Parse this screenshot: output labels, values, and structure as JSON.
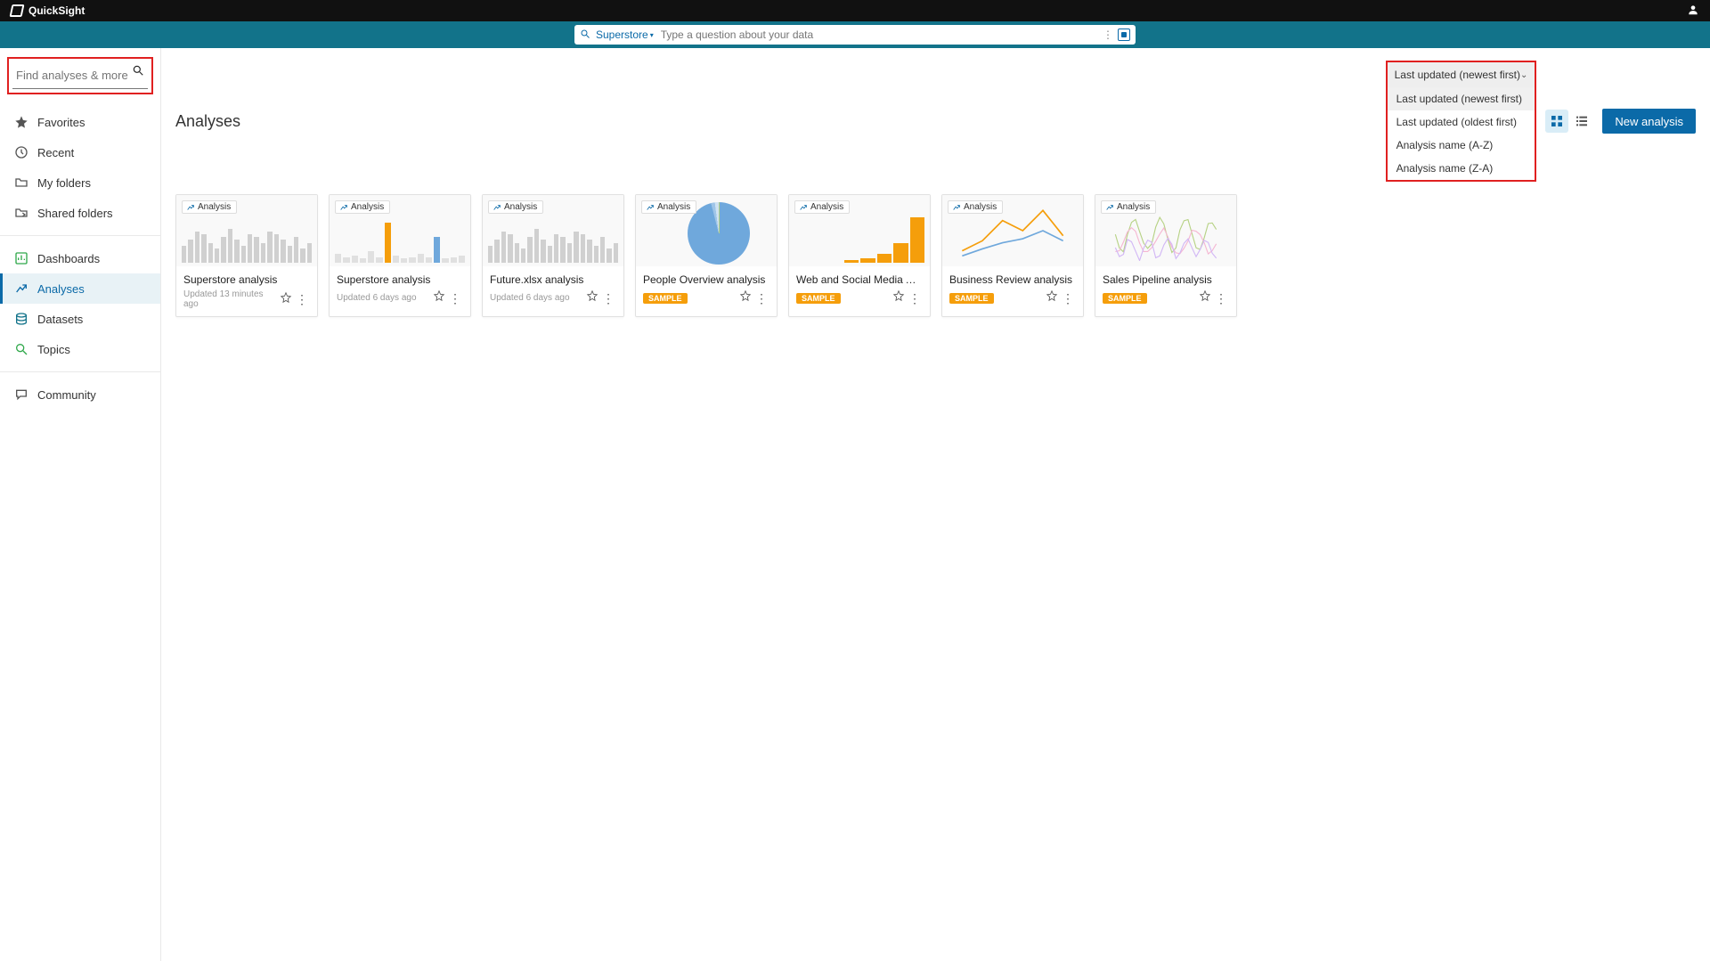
{
  "brand": "QuickSight",
  "askbar": {
    "topic": "Superstore",
    "placeholder": "Type a question about your data"
  },
  "side_search": {
    "placeholder": "Find analyses & more"
  },
  "sidebar": {
    "items": [
      {
        "label": "Favorites",
        "icon": "star"
      },
      {
        "label": "Recent",
        "icon": "clock"
      },
      {
        "label": "My folders",
        "icon": "folder"
      },
      {
        "label": "Shared folders",
        "icon": "folder-share"
      }
    ],
    "items2": [
      {
        "label": "Dashboards",
        "icon": "dashboard",
        "color": "#2fa84a"
      },
      {
        "label": "Analyses",
        "icon": "analysis",
        "color": "#0b6aa8",
        "selected": true
      },
      {
        "label": "Datasets",
        "icon": "dataset",
        "color": "#12738a"
      },
      {
        "label": "Topics",
        "icon": "topic",
        "color": "#2fa84a"
      }
    ],
    "items3": [
      {
        "label": "Community",
        "icon": "chat"
      }
    ]
  },
  "page": {
    "title": "Analyses",
    "sort_selected": "Last updated (newest first)",
    "sort_options": [
      "Last updated (newest first)",
      "Last updated (oldest first)",
      "Analysis name (A-Z)",
      "Analysis name (Z-A)"
    ],
    "new_button": "New analysis",
    "card_tag": "Analysis",
    "sample_badge": "SAMPLE"
  },
  "cards": [
    {
      "title": "Superstore analysis",
      "meta": "Updated 13 minutes ago",
      "thumb": "bars-gray"
    },
    {
      "title": "Superstore analysis",
      "meta": "Updated 6 days ago",
      "thumb": "bars-accent"
    },
    {
      "title": "Future.xlsx analysis",
      "meta": "Updated 6 days ago",
      "thumb": "bars-gray"
    },
    {
      "title": "People Overview analysis",
      "sample": true,
      "thumb": "pie"
    },
    {
      "title": "Web and Social Media Anal…",
      "sample": true,
      "thumb": "bars-orange"
    },
    {
      "title": "Business Review analysis",
      "sample": true,
      "thumb": "lines"
    },
    {
      "title": "Sales Pipeline analysis",
      "sample": true,
      "thumb": "squiggle"
    }
  ]
}
